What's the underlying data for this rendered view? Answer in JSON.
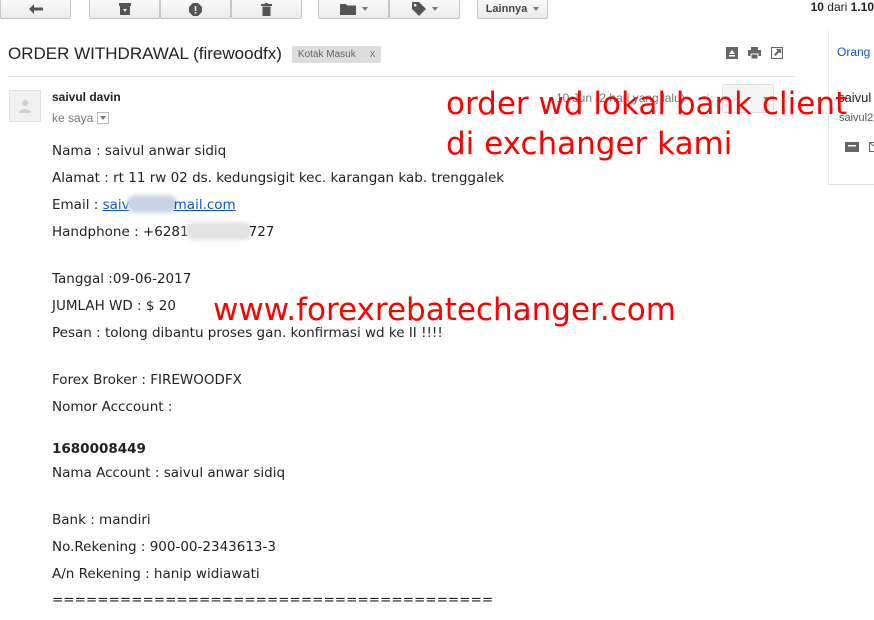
{
  "toolbar": {
    "back_icon": "arrow-left-icon",
    "archive_icon": "archive-icon",
    "spam_icon": "report-spam-icon",
    "delete_icon": "trash-icon",
    "folder_icon": "folder-icon",
    "label_icon": "tag-icon",
    "more_label": "Lainnya",
    "pager_range": "10",
    "pager_of": "dari",
    "pager_total": "1.10"
  },
  "message": {
    "subject": "ORDER WITHDRAWAL (firewoodfx)",
    "label": "Kotak Masuk",
    "label_remove": "x",
    "sender_name": "saivul davin",
    "recipient": "ke saya",
    "date": "10 Jun (2 hari yang lalu)"
  },
  "right_panel": {
    "header": "Orang",
    "name": "saivul",
    "email": "saivul2"
  },
  "body": {
    "nama": "Nama : saivul anwar sidiq",
    "alamat": "Alamat : rt 11 rw 02 ds. kedungsigit kec. karangan kab. trenggalek",
    "email_label": "Email : ",
    "email_start": "saiv",
    "email_end": "mail.com",
    "phone_start": "Handphone : +6281",
    "phone_end": "727",
    "tanggal": "Tanggal :09-06-2017",
    "jumlah": "JUMLAH WD : $ 20",
    "pesan": "Pesan : tolong dibantu proses gan. konfirmasi wd ke II !!!!",
    "broker": "Forex Broker : FIREWOODFX",
    "nomor_label": "Nomor Acccount :",
    "account_number": "1680008449",
    "nama_account": "Nama Account : saivul anwar sidiq",
    "bank": "Bank : mandiri",
    "rekening": "No.Rekening : 900-00-2343613-3",
    "an_rekening": "A/n Rekening : hanip widiawati",
    "separator": "======================================="
  },
  "annotations": {
    "line1": "order wd lokal bank client",
    "line2": "di exchanger kami",
    "website": "www.forexrebatechanger.com",
    "color": "#ff0000"
  }
}
